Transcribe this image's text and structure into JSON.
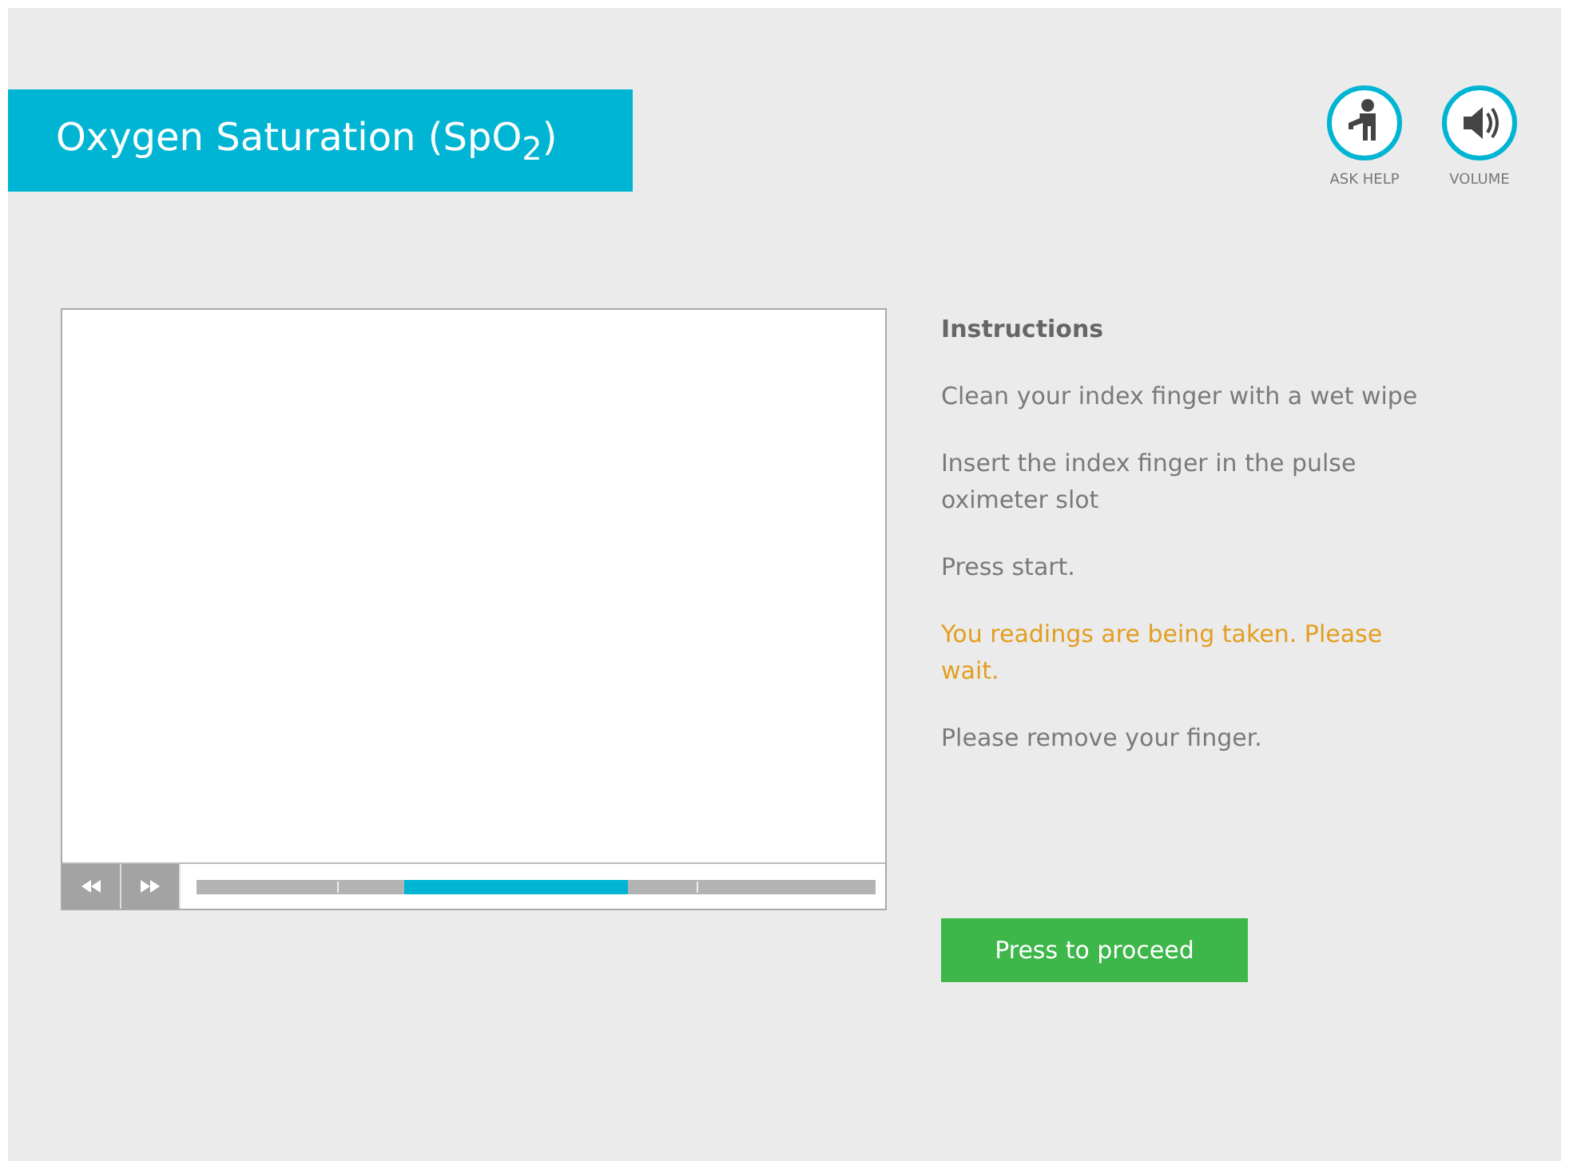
{
  "header": {
    "title": "Oxygen Saturation (SpO$_{2}$)"
  },
  "actions": [
    {
      "kind": "help",
      "label": "ASK HELP"
    },
    {
      "kind": "volume",
      "label": "VOLUME"
    }
  ],
  "instructions": {
    "heading": "Instructions",
    "steps": [
      {
        "text": "Clean your index finger with a wet wipe",
        "highlighted": false
      },
      {
        "text": "Insert the index finger in the pulse oximeter slot",
        "highlighted": false
      },
      {
        "text": "Press start.",
        "highlighted": false
      },
      {
        "text": "You readings are being taken. Please wait.",
        "highlighted": true
      },
      {
        "text": "Please remove your finger.",
        "highlighted": false
      }
    ]
  },
  "proceed_button": "Press to proceed"
}
